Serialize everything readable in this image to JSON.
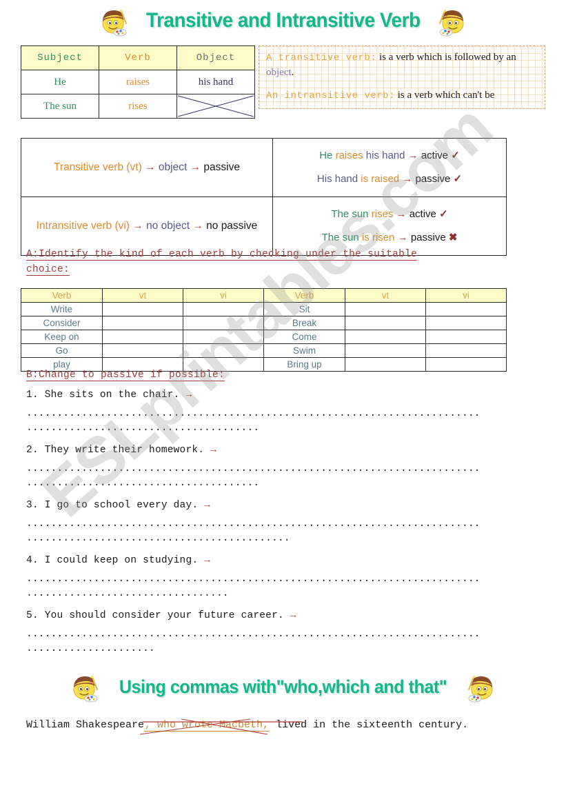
{
  "headings": {
    "main_title": "Transitive and Intransitive Verb",
    "second_title": "Using commas with\"who,which and that\""
  },
  "watermark": {
    "text": "ESLprintables.com"
  },
  "svo_table": {
    "headers": [
      "Subject",
      "Verb",
      "Object"
    ],
    "rows": [
      {
        "subject": "He",
        "verb": "raises",
        "object": "his hand",
        "object_crossed": false
      },
      {
        "subject": "The sun",
        "verb": "rises",
        "object": "",
        "object_crossed": true
      }
    ]
  },
  "definition_box": {
    "line1_term": "A transitive verb:",
    "line1_text_a": " is a verb which is followed by an ",
    "line1_object": "object",
    "line1_text_b": ".",
    "line2_term": "An intransitive verb:",
    "line2_text": " is a verb which can't be"
  },
  "rules_table": {
    "rows": [
      {
        "rule": {
          "a": "Transitive verb (vt)",
          "arrow1": "→",
          "b": "object",
          "arrow2": "→",
          "c": "passive"
        },
        "examples": [
          {
            "subject": "He",
            "verb": "raises",
            "rest": "his hand",
            "arrow": "→",
            "voice": "active",
            "mark": "✓",
            "mark_type": "tick"
          },
          {
            "subject": "His hand",
            "verb": "is raised",
            "rest": "",
            "arrow": "→",
            "voice": "passive",
            "mark": "✓",
            "mark_type": "tick"
          }
        ]
      },
      {
        "rule": {
          "a": "Intransitive verb (vi)",
          "arrow1": "→",
          "b": "no object",
          "arrow2": "→",
          "c": "no passive"
        },
        "examples": [
          {
            "subject": "The sun",
            "verb": "rises",
            "rest": "",
            "arrow": "→",
            "voice": "active",
            "mark": "✓",
            "mark_type": "tick"
          },
          {
            "subject": "The sun",
            "verb": "is risen",
            "rest": "",
            "arrow": "→",
            "voice": "passive",
            "mark": "✖",
            "mark_type": "cross"
          }
        ]
      }
    ]
  },
  "section_a": {
    "instruction_line1": "A:Identify the kind of each verb by checking under the suitable",
    "instruction_line2": "choice:"
  },
  "verb_tables": {
    "headers": [
      "Verb",
      "vt",
      "vi"
    ],
    "left_verbs": [
      "Write",
      "Consider",
      "Keep on",
      "Go",
      "play"
    ],
    "right_verbs": [
      "Sit",
      "Break",
      "Come",
      "Swim",
      "Bring up"
    ]
  },
  "section_b": {
    "instruction": "B:Change to passive if possible:",
    "items": [
      {
        "number": "1.",
        "sentence": "She sits on the chair.",
        "arrow": "→",
        "dots_line1": "..........................................................................",
        "dots_line2": "......................................"
      },
      {
        "number": "2.",
        "sentence": "They write their homework.",
        "arrow": "→",
        "dots_line1": "..........................................................................",
        "dots_line2": "......................................"
      },
      {
        "number": "3.",
        "sentence": "I go to school every day.",
        "arrow": "→",
        "dots_line1": "..........................................................................",
        "dots_line2": "..........................................."
      },
      {
        "number": "4.",
        "sentence": "I could keep on studying.",
        "arrow": "→",
        "dots_line1": "..........................................................................",
        "dots_line2": "................................."
      },
      {
        "number": "5.",
        "sentence": "You should consider your future career.",
        "arrow": "→",
        "dots_line1": "..........................................................................",
        "dots_line2": "....................."
      }
    ]
  },
  "bottom_example": {
    "part1": "William Shakespeare",
    "clause": ", who wrote Macbeth,",
    "part2": " lived in the sixteenth century."
  },
  "colors": {
    "title_teal": "#18b58c",
    "header_yellow": "#fdfcc9",
    "orange": "#e08a2e",
    "green": "#2c8f63",
    "red_arrow": "#c0392b",
    "instruction_red": "#a33b3b",
    "verb_blue": "#5b7a8c",
    "purple": "#5a5a8c"
  }
}
